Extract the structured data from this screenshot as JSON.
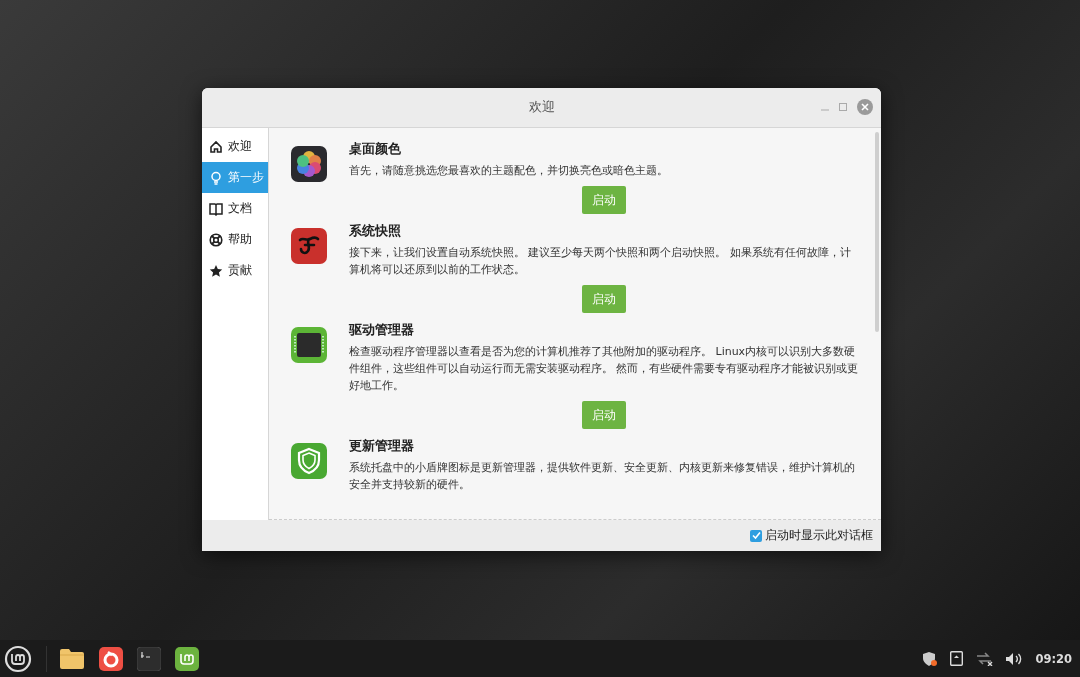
{
  "window": {
    "title": "欢迎"
  },
  "sidebar": {
    "items": [
      {
        "label": "欢迎",
        "kind": "home",
        "selected": false
      },
      {
        "label": "第一步",
        "kind": "bulb",
        "selected": true
      },
      {
        "label": "文档",
        "kind": "book",
        "selected": false
      },
      {
        "label": "帮助",
        "kind": "lifebuoy",
        "selected": false
      },
      {
        "label": "贡献",
        "kind": "star",
        "selected": false
      }
    ]
  },
  "steps": [
    {
      "kind": "colors",
      "title": "桌面颜色",
      "description": "首先，请随意挑选您最喜欢的主题配色，并切换亮色或暗色主题。",
      "button": "启动"
    },
    {
      "kind": "snapshot",
      "title": "系统快照",
      "description": "接下来，让我们设置自动系统快照。 建议至少每天两个快照和两个启动快照。 如果系统有任何故障，计算机将可以还原到以前的工作状态。",
      "button": "启动"
    },
    {
      "kind": "chip",
      "title": "驱动管理器",
      "description": "检查驱动程序管理器以查看是否为您的计算机推荐了其他附加的驱动程序。 Linux内核可以识别大多数硬件组件，这些组件可以自动运行而无需安装驱动程序。 然而，有些硬件需要专有驱动程序才能被识别或更好地工作。",
      "button": "启动"
    },
    {
      "kind": "shield",
      "title": "更新管理器",
      "description": "系统托盘中的小盾牌图标是更新管理器，提供软件更新、安全更新、内核更新来修复错误，维护计算机的安全并支持较新的硬件。"
    }
  ],
  "footer": {
    "checkbox": {
      "label": "启动时显示此对话框",
      "checked": true
    }
  },
  "taskbar": {
    "clock": "09:20"
  }
}
